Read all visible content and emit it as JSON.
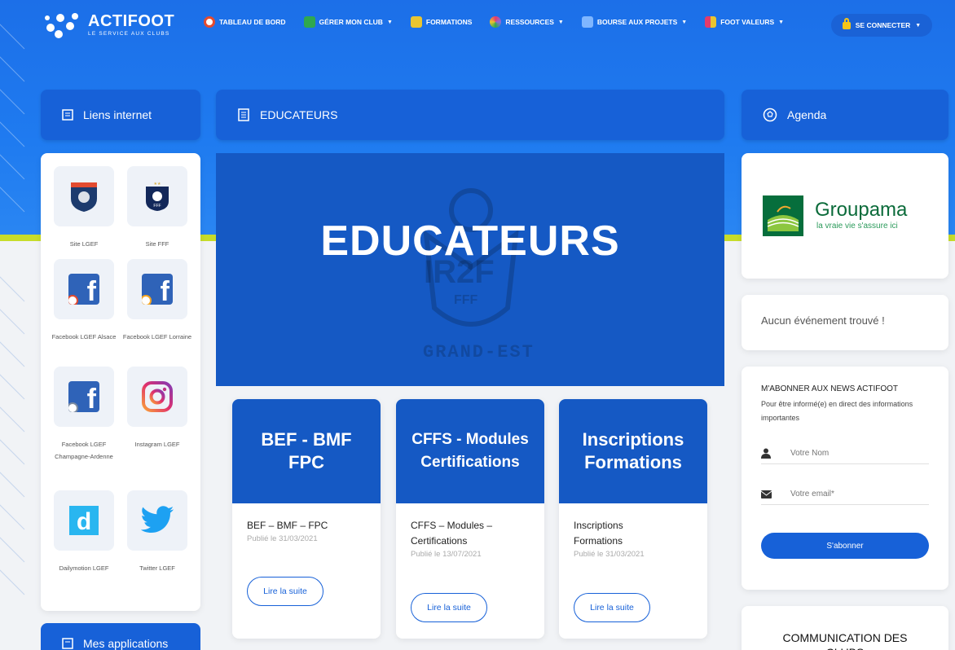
{
  "brand": {
    "name": "ACTIFOOT",
    "tagline": "LE SERVICE AUX CLUBS"
  },
  "nav": {
    "items": [
      {
        "label": "TABLEAU DE BORD",
        "icon": "dashboard-icon",
        "caret": false,
        "color": "#ffffff"
      },
      {
        "label": "GÉRER MON CLUB",
        "icon": "club-icon",
        "caret": true,
        "color": "#2fa84f"
      },
      {
        "label": "FORMATIONS",
        "icon": "formations-icon",
        "caret": false,
        "color": "#e9c531"
      },
      {
        "label": "RESSOURCES",
        "icon": "resources-icon",
        "caret": true,
        "color": "#8a6de0"
      },
      {
        "label": "BOURSE AUX PROJETS",
        "icon": "projects-icon",
        "caret": true,
        "color": "#7fb6ff"
      },
      {
        "label": "FOOT VALEURS",
        "icon": "values-icon",
        "caret": true,
        "color": "#e53b6a"
      }
    ],
    "login_label": "SE CONNECTER"
  },
  "left": {
    "header": "Liens internet",
    "links": [
      {
        "label": "Site LGEF",
        "icon": "lgef-badge-icon"
      },
      {
        "label": "Site FFF",
        "icon": "fff-badge-icon"
      },
      {
        "label": "Facebook LGEF Alsace",
        "icon": "facebook-icon"
      },
      {
        "label": "Facebook LGEF Lorraine",
        "icon": "facebook-icon"
      },
      {
        "label": "Facebook LGEF Champagne-Ardenne",
        "icon": "facebook-icon"
      },
      {
        "label": "Instagram LGEF",
        "icon": "instagram-icon"
      },
      {
        "label": "Dailymotion LGEF",
        "icon": "dailymotion-icon"
      },
      {
        "label": "Twitter LGEF",
        "icon": "twitter-icon"
      }
    ],
    "apps_header": "Mes applications"
  },
  "center": {
    "header": "EDUCATEURS",
    "banner_title": "EDUCATEURS",
    "banner_watermark": {
      "ir2f": "IR2F",
      "fff": "FFF",
      "region": "GRAND-EST"
    },
    "articles": [
      {
        "image_title": "BEF - BMF FPC",
        "title": "BEF – BMF – FPC",
        "date": "Publié le 31/03/2021",
        "read_more": "Lire la suite"
      },
      {
        "image_title": "CFFS - Modules Certifications",
        "title": "CFFS – Modules – Certifications",
        "date": "Publié le 13/07/2021",
        "read_more": "Lire la suite"
      },
      {
        "image_title": "Inscriptions Formations",
        "title": "Inscriptions Formations",
        "date": "Publié le 31/03/2021",
        "read_more": "Lire la suite"
      }
    ]
  },
  "right": {
    "header": "Agenda",
    "sponsor": {
      "name": "Groupama",
      "tagline": "la vraie vie s'assure ici"
    },
    "no_event": "Aucun événement trouvé !",
    "newsletter": {
      "title": "M'ABONNER AUX NEWS ACTIFOOT",
      "desc": "Pour être informé(e) en direct des informations importantes",
      "name_placeholder": "Votre Nom",
      "email_placeholder": "Votre email*",
      "submit": "S'abonner"
    },
    "communication": "COMMUNICATION DES CLUBS"
  },
  "colors": {
    "primary": "#1761d8",
    "banner": "#1559c4",
    "accent_line": "#c7dc2a"
  }
}
